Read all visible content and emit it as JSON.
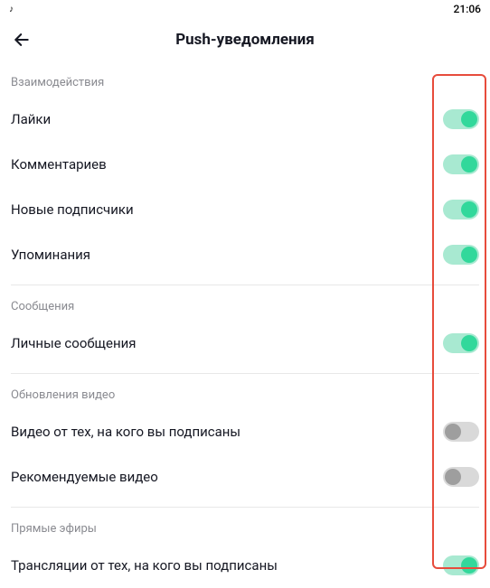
{
  "statusBar": {
    "leftIcon": "♪",
    "time": "21:06"
  },
  "header": {
    "title": "Push-уведомления"
  },
  "sections": [
    {
      "title": "Взаимодействия",
      "items": [
        {
          "label": "Лайки",
          "on": true
        },
        {
          "label": "Комментариев",
          "on": true
        },
        {
          "label": "Новые подписчики",
          "on": true
        },
        {
          "label": "Упоминания",
          "on": true
        }
      ]
    },
    {
      "title": "Сообщения",
      "items": [
        {
          "label": "Личные сообщения",
          "on": true
        }
      ]
    },
    {
      "title": "Обновления видео",
      "items": [
        {
          "label": "Видео от тех, на кого вы подписаны",
          "on": false
        },
        {
          "label": "Рекомендуемые видео",
          "on": false
        }
      ]
    },
    {
      "title": "Прямые эфиры",
      "items": [
        {
          "label": "Трансляции от тех, на кого вы подписаны",
          "on": true
        }
      ]
    }
  ]
}
